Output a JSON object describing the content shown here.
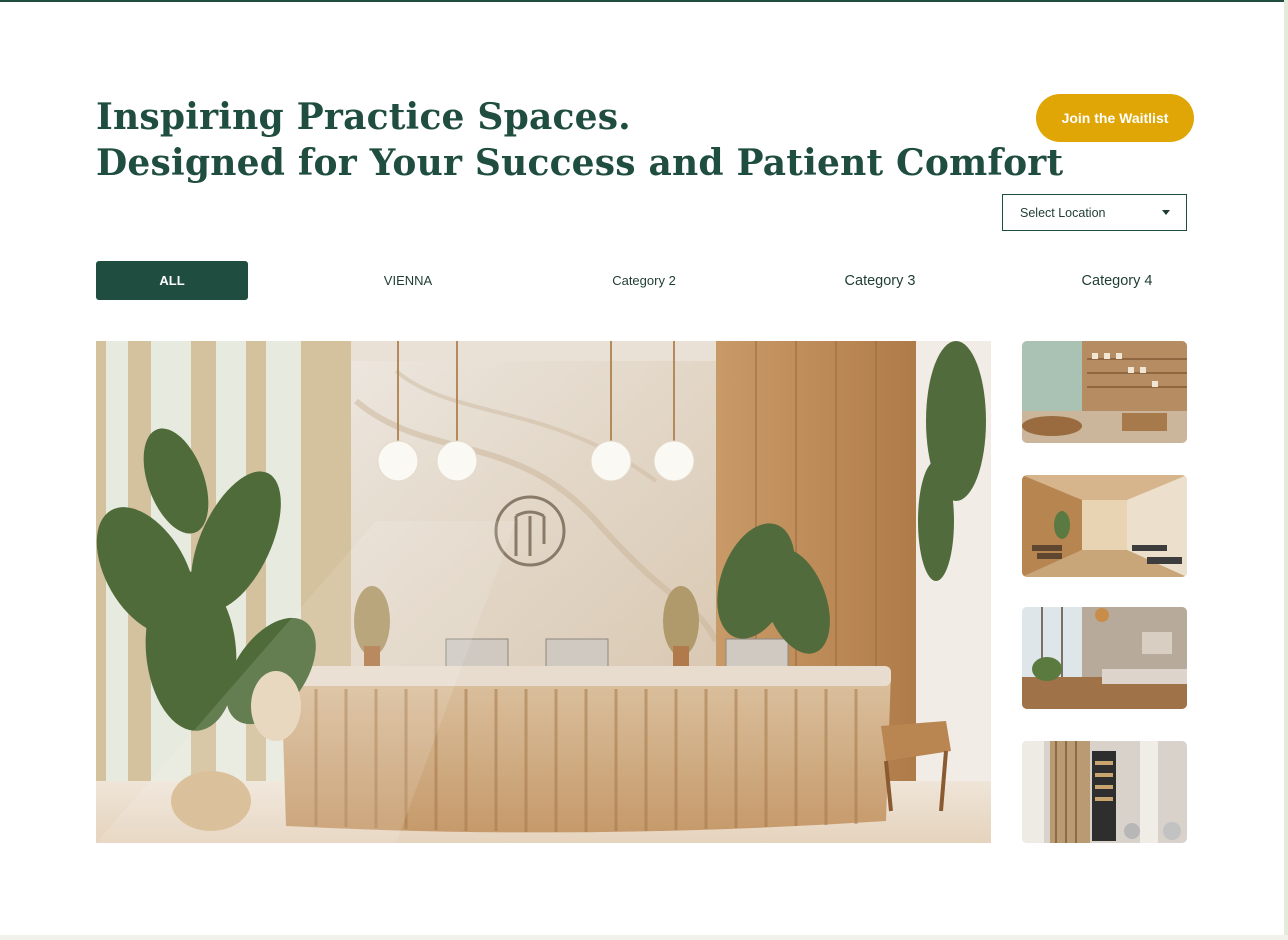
{
  "header": {
    "headline_line1": "Inspiring Practice Spaces.",
    "headline_line2": "Designed for Your Success and Patient Comfort",
    "cta_label": "Join the Waitlist"
  },
  "location_select": {
    "selected": "Select Location",
    "icon": "caret-down-icon"
  },
  "tabs": [
    {
      "label": "ALL",
      "active": true
    },
    {
      "label": "VIENNA",
      "active": false
    },
    {
      "label": "Category 2",
      "active": false
    },
    {
      "label": "Category 3",
      "active": false
    },
    {
      "label": "Category 4",
      "active": false
    }
  ],
  "gallery": {
    "main_image": "reception-desk-photo",
    "thumbnails": [
      "pharmacy-shelves-photo",
      "gym-corridor-photo",
      "lounge-windows-photo",
      "studio-rack-photo"
    ]
  },
  "colors": {
    "brand_green": "#1f4d3f",
    "accent_gold": "#dfa606"
  }
}
